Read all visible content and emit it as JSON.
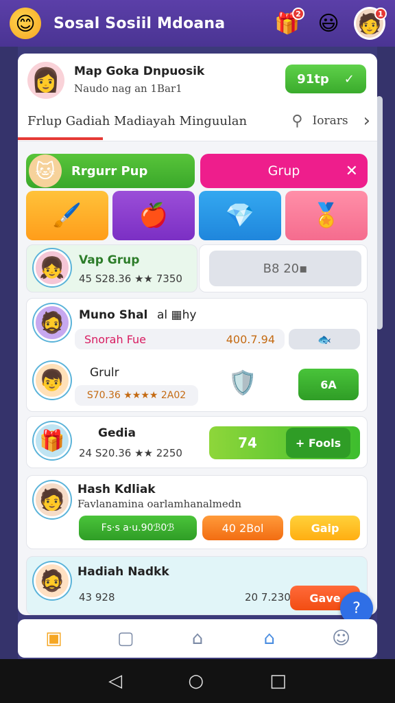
{
  "header": {
    "app_logo": "smiley-icon",
    "title": "Sosal Sosiil Mdoana",
    "icons": [
      {
        "name": "gift-box-icon",
        "badge": "2"
      },
      {
        "name": "emoji-icon",
        "badge": ""
      },
      {
        "name": "avatar-icon",
        "badge": "1"
      }
    ]
  },
  "profile": {
    "name": "Map Goka Dnpuosik",
    "subtitle": "Naudo nag an 1Bar1",
    "signup_label": "91tp",
    "signup_check": "✓",
    "filter_text": "Frlup  Gadiah Madiayah Minguulan",
    "sort_label": "Iorars"
  },
  "tabs": {
    "green_label": "Rrgurr Pup",
    "pink_label": "Grup",
    "pink_close": "✕"
  },
  "rows": {
    "r1": {
      "title": "Vap Grup",
      "stats": "45  S28.36 ★★ 7350",
      "side_value": "B8 20▪"
    },
    "r2": {
      "title": "Muno Shal",
      "title_suffix": "al ▦hy",
      "pill_left": "Snorah Fue",
      "pill_value": "400.7.94",
      "sub_title": "Grulr",
      "sub_stats": "S70.36 ★★★★ 2A02",
      "action": "6A"
    },
    "r3": {
      "title": "Gedia",
      "stats": "24   S20.36 ★★ 2250",
      "btn_value": "74",
      "btn_label": "+ Fools"
    },
    "r4": {
      "title": "Hash Kdliak",
      "subtitle": "Favlanamina oarlamhanalmedn",
      "pill1": "Fs·s a·u.90ℬ0ℬ",
      "pill2": "40 2Bol",
      "pill3": "Gaip"
    },
    "r5": {
      "title": "Hadiah Nadkk",
      "stats_left": "43  928",
      "stats_right": "20 7.230",
      "btn": "Gave"
    }
  },
  "nav": {
    "fab": "?"
  },
  "colors": {
    "header_purple": "#5b3fa8",
    "green": "#3aab2c",
    "pink": "#ee1e8c",
    "orange": "#ff8c1a",
    "blue": "#2f6fe6"
  }
}
